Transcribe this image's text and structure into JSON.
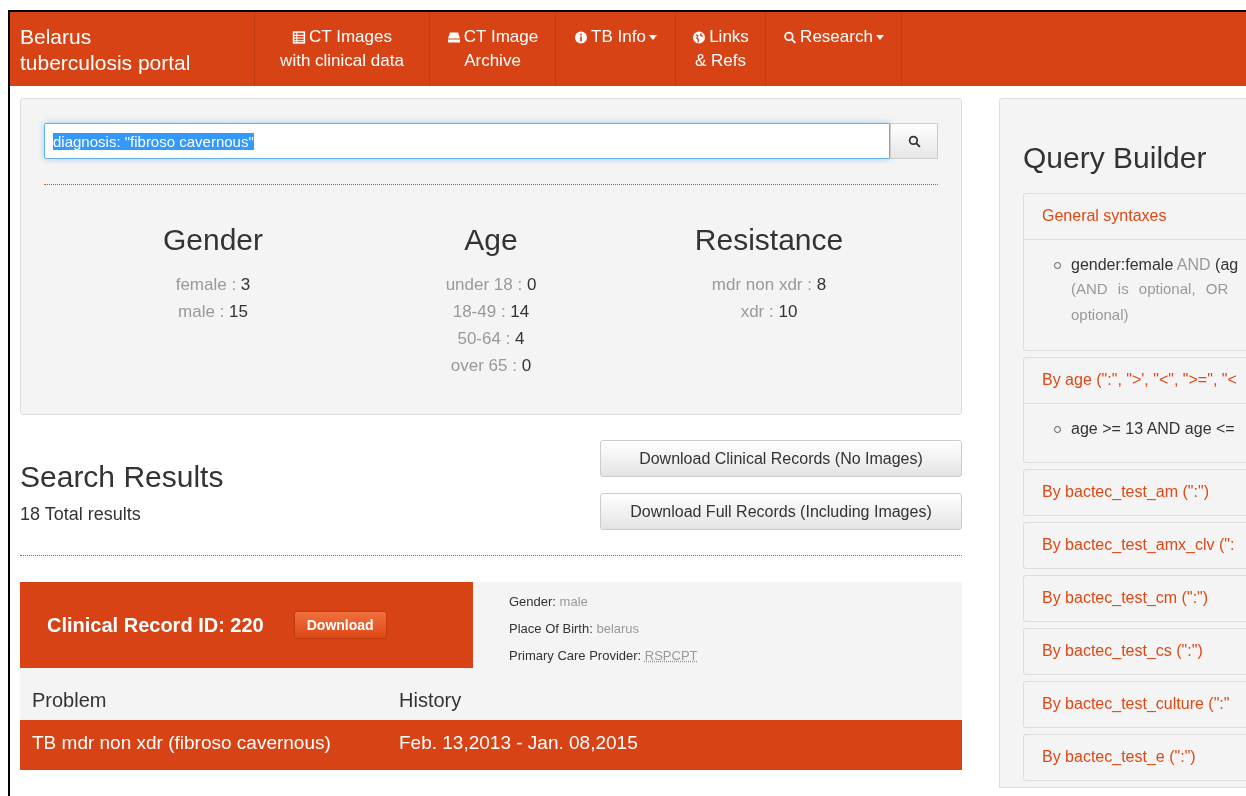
{
  "navbar": {
    "brand": [
      "Belarus",
      "tuberculosis portal"
    ],
    "items": [
      {
        "lines": [
          "CT Images",
          "with clinical data"
        ],
        "dropdown": false
      },
      {
        "lines": [
          "CT Image",
          "Archive"
        ],
        "dropdown": false
      },
      {
        "lines": [
          "TB Info"
        ],
        "dropdown": true
      },
      {
        "lines": [
          "Links",
          "& Refs"
        ],
        "dropdown": false
      },
      {
        "lines": [
          "Research"
        ],
        "dropdown": true
      }
    ]
  },
  "search": {
    "value": "diagnosis: \"fibroso cavernous\"",
    "text_selected": true
  },
  "stats": [
    {
      "title": "Gender",
      "rows": [
        {
          "label": "female :",
          "value": "3"
        },
        {
          "label": "male :",
          "value": "15"
        }
      ]
    },
    {
      "title": "Age",
      "rows": [
        {
          "label": "under 18 :",
          "value": "0"
        },
        {
          "label": "18-49 :",
          "value": "14"
        },
        {
          "label": "50-64 :",
          "value": "4"
        },
        {
          "label": "over 65 :",
          "value": "0"
        }
      ]
    },
    {
      "title": "Resistance",
      "rows": [
        {
          "label": "mdr non xdr :",
          "value": "8"
        },
        {
          "label": "xdr :",
          "value": "10"
        }
      ]
    }
  ],
  "results": {
    "title": "Search Results",
    "total": "18 Total results",
    "buttons": [
      "Download Clinical Records (No Images)",
      "Download Full Records (Including Images)"
    ]
  },
  "record": {
    "title": "Clinical Record ID: 220",
    "button": "Download",
    "fields": [
      {
        "label": "Gender:",
        "value": "male",
        "kind": "plain"
      },
      {
        "label": "Place Of Birth:",
        "value": "belarus",
        "kind": "plain"
      },
      {
        "label": "Primary Care Provider:",
        "value": "RSPCPT",
        "kind": "abbr"
      }
    ],
    "columns": [
      "Problem",
      "History"
    ],
    "rows": [
      [
        "TB mdr non xdr (fibroso cavernous)",
        "Feb. 13,2013 - Jan. 08,2015"
      ]
    ]
  },
  "query_builder": {
    "title": "Query Builder",
    "panels": [
      {
        "heading": "General syntaxes",
        "items": [
          {
            "parts": [
              {
                "text": "gender:female",
                "kind": "term"
              },
              {
                "text": "AND",
                "kind": "op"
              },
              {
                "text": "(ag",
                "kind": "term"
              }
            ],
            "notes": [
              "(AND is optional, OR",
              "optional)"
            ]
          }
        ]
      },
      {
        "heading": "By age (\":\", \">', \"<\", \">=\", \"<",
        "items": [
          {
            "parts": [
              {
                "text": "age >= 13 AND age <=",
                "kind": "term"
              }
            ]
          }
        ]
      },
      {
        "heading": "By bactec_test_am (\":\")"
      },
      {
        "heading": "By bactec_test_amx_clv (\":"
      },
      {
        "heading": "By bactec_test_cm (\":\")"
      },
      {
        "heading": "By bactec_test_cs (\":\")"
      },
      {
        "heading": "By bactec_test_culture (\":\""
      },
      {
        "heading": "By bactec_test_e (\":\")"
      }
    ]
  }
}
